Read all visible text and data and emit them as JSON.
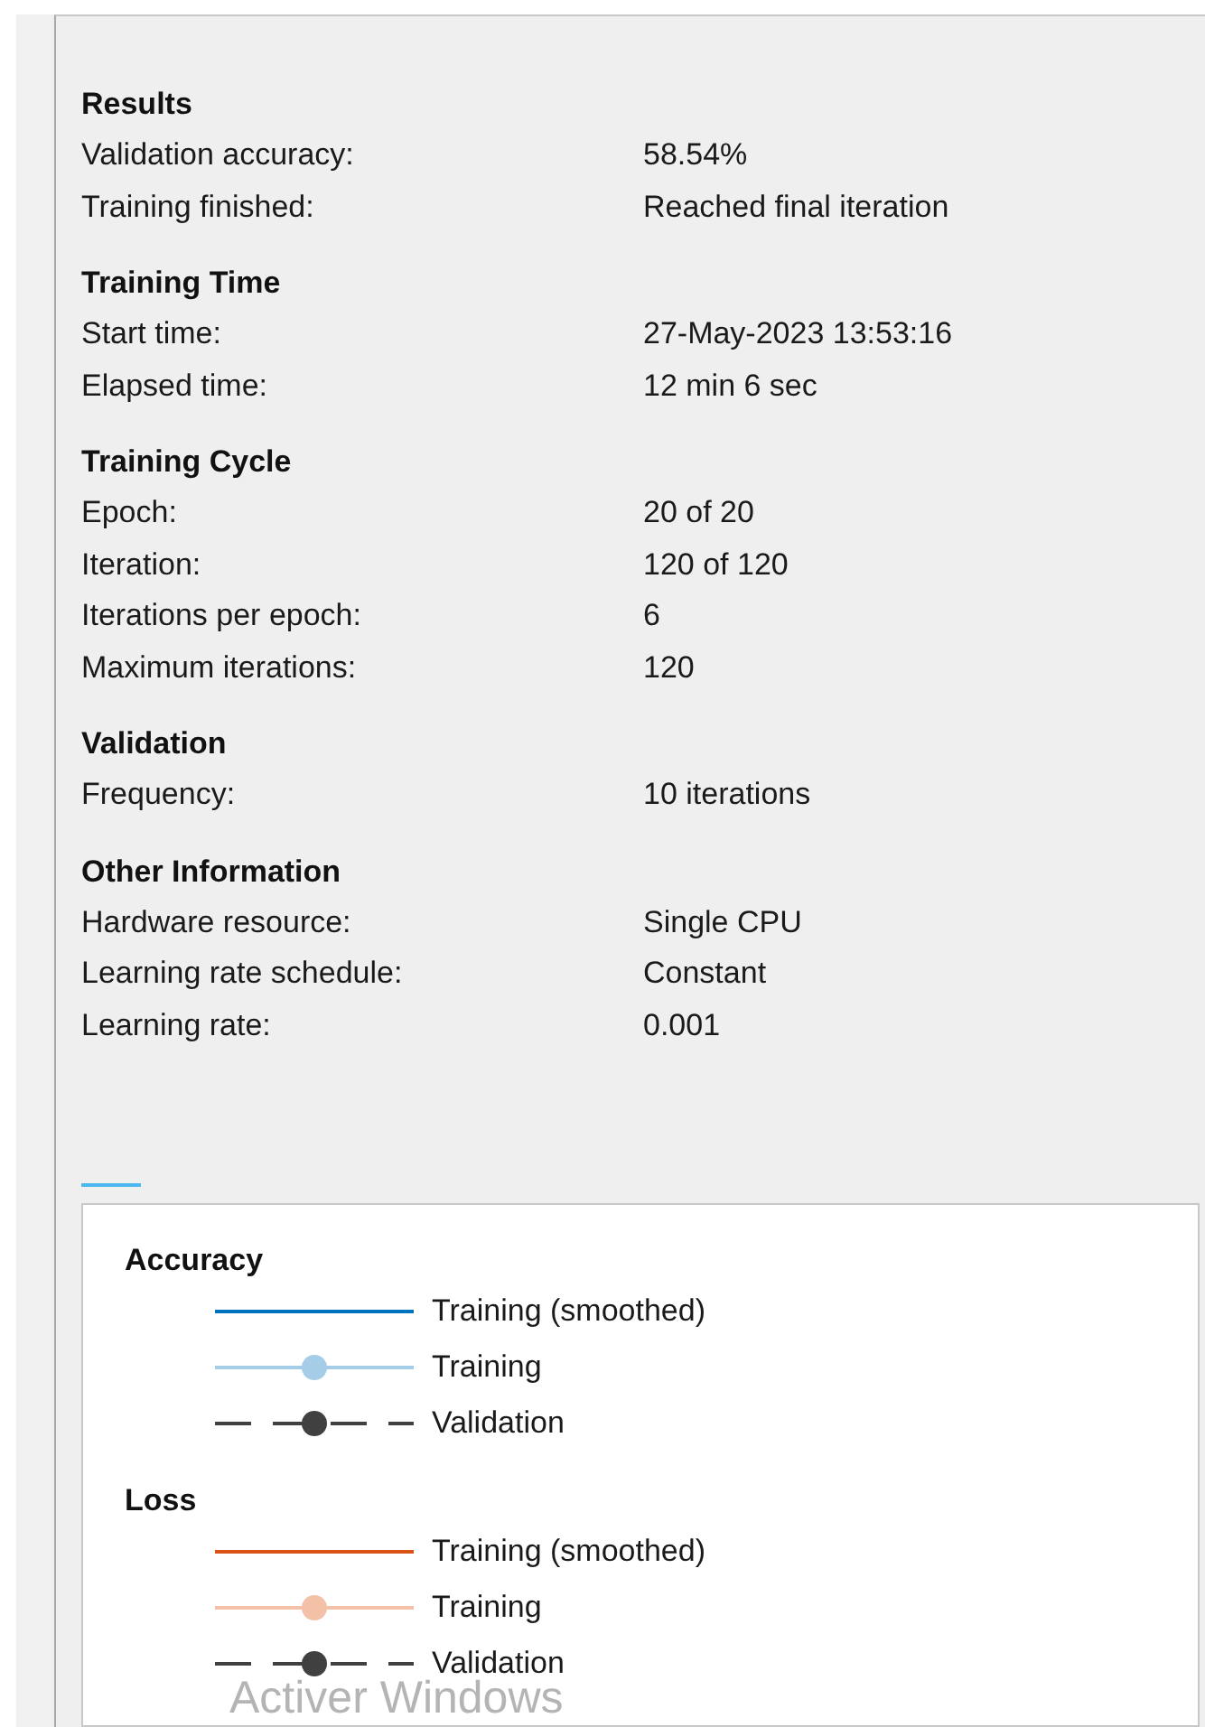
{
  "sections": [
    {
      "title": "Results",
      "rows": [
        {
          "label": "Validation accuracy:",
          "value": "58.54%"
        },
        {
          "label": "Training finished:",
          "value": "Reached final iteration"
        }
      ]
    },
    {
      "title": "Training Time",
      "rows": [
        {
          "label": "Start time:",
          "value": "27-May-2023 13:53:16"
        },
        {
          "label": "Elapsed time:",
          "value": "12 min 6 sec"
        }
      ]
    },
    {
      "title": "Training Cycle",
      "rows": [
        {
          "label": "Epoch:",
          "value": "20 of 20"
        },
        {
          "label": "Iteration:",
          "value": "120 of 120"
        },
        {
          "label": "Iterations per epoch:",
          "value": "6"
        },
        {
          "label": "Maximum iterations:",
          "value": "120"
        }
      ]
    },
    {
      "title": "Validation",
      "rows": [
        {
          "label": "Frequency:",
          "value": "10 iterations"
        }
      ]
    },
    {
      "title": "Other Information",
      "rows": [
        {
          "label": "Hardware resource:",
          "value": "Single CPU"
        },
        {
          "label": "Learning rate schedule:",
          "value": "Constant"
        },
        {
          "label": "Learning rate:",
          "value": "0.001"
        }
      ]
    }
  ],
  "legend": [
    {
      "title": "Accuracy",
      "items": [
        {
          "kind": "line",
          "color": "#0072bd",
          "label": "Training (smoothed)"
        },
        {
          "kind": "marker",
          "color": "#a6cde8",
          "label": "Training"
        },
        {
          "kind": "dashed",
          "color": "#404040",
          "label": "Validation"
        }
      ]
    },
    {
      "title": "Loss",
      "items": [
        {
          "kind": "line",
          "color": "#d95319",
          "label": "Training (smoothed)"
        },
        {
          "kind": "marker",
          "color": "#f3c1a8",
          "label": "Training"
        },
        {
          "kind": "dashed",
          "color": "#404040",
          "label": "Validation"
        }
      ]
    }
  ],
  "watermark": "Activer Windows"
}
